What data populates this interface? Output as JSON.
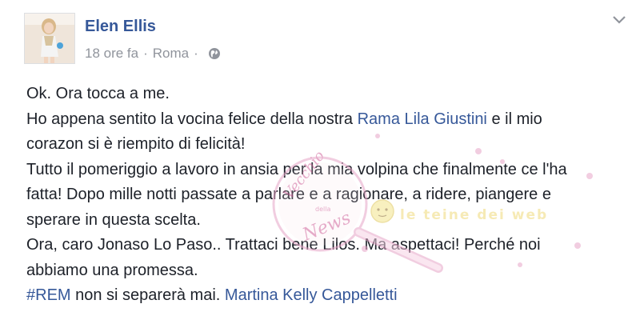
{
  "post": {
    "author": "Elen Ellis",
    "time": "18 ore fa",
    "location": "Roma",
    "text": {
      "l1": "Ok. Ora tocca a me.",
      "l2a": "Ho appena sentito la vocina felice della nostra ",
      "mention1": "Rama Lila Giustini",
      "l2b": " e il mio",
      "l3": "corazon si è riempito di felicità!",
      "l4": "Tutto il pomeriggio a lavoro in ansia per la mia volpina che finalmente ce l'ha",
      "l5": "fatta! Dopo mille notti passate a parlare e a ragionare, a ridere, piangere e",
      "l6": "sperare in questa scelta.",
      "l7": "Ora, caro Jonaso Lo Paso.. Trattaci bene Lilos. Ma aspettaci! Perché noi",
      "l8": "abbiamo una promessa.",
      "hashtag": "#REM",
      "l9": " non si separerà mai. ",
      "mention2": "Martina Kelly Cappelletti"
    }
  },
  "icons": {
    "avatar": "avatar",
    "globe": "globe-icon",
    "chevron": "chevron-down-icon"
  },
  "colors": {
    "link": "#365899",
    "meta": "#90949c",
    "text": "#1d2129",
    "watermark_pink": "#e7a6c8",
    "watermark_yellow": "#f3e58c"
  },
  "watermark": {
    "left_text_1": "Vecchio",
    "left_text_2": "della",
    "left_text_3": "News",
    "right_text": "le teine dei web"
  }
}
